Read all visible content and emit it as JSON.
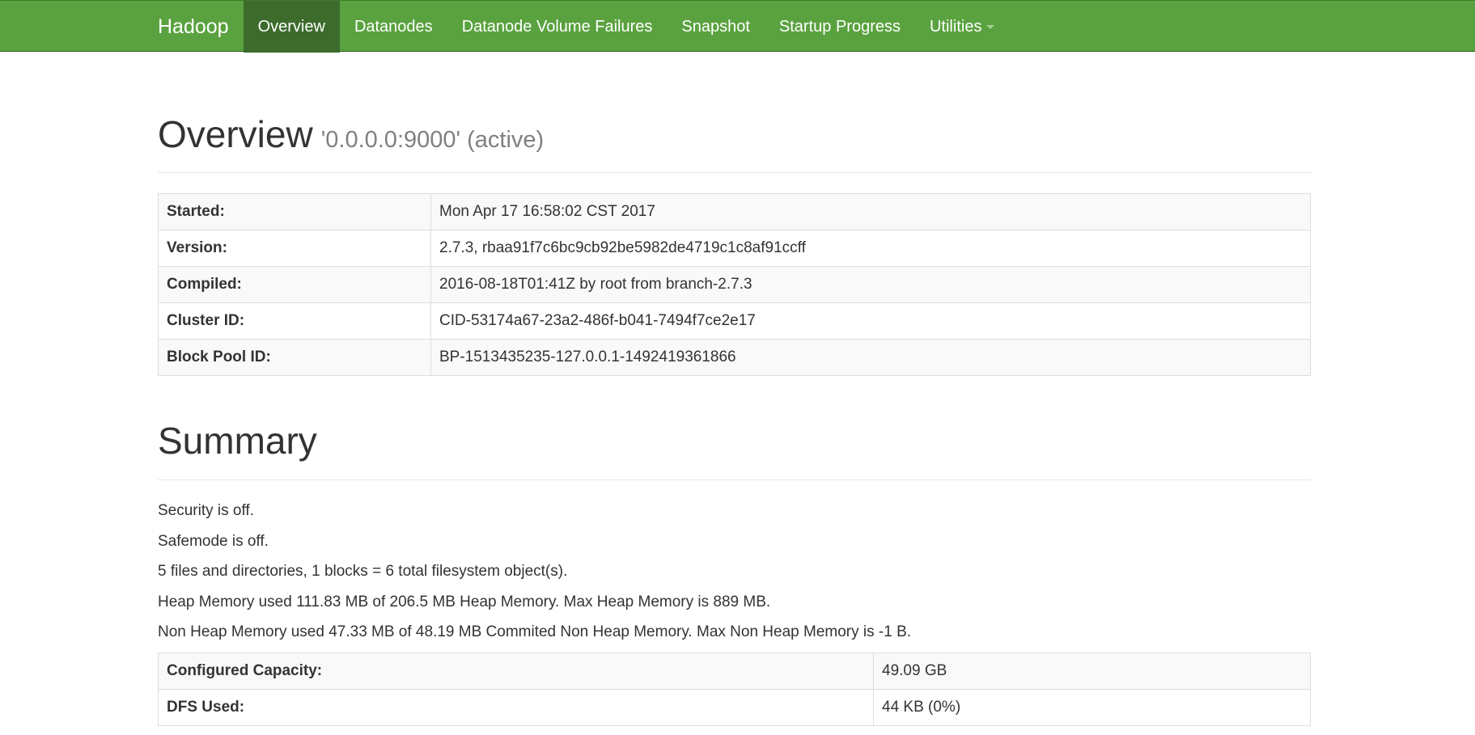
{
  "navbar": {
    "brand": "Hadoop",
    "items": [
      {
        "label": "Overview",
        "active": true
      },
      {
        "label": "Datanodes",
        "active": false
      },
      {
        "label": "Datanode Volume Failures",
        "active": false
      },
      {
        "label": "Snapshot",
        "active": false
      },
      {
        "label": "Startup Progress",
        "active": false
      },
      {
        "label": "Utilities",
        "active": false,
        "dropdown": true
      }
    ],
    "bg_color": "#5aa23f",
    "active_color": "#3c6b2c"
  },
  "overview": {
    "title": "Overview",
    "subtitle": "'0.0.0.0:9000' (active)",
    "rows": [
      {
        "key": "Started:",
        "value": "Mon Apr 17 16:58:02 CST 2017"
      },
      {
        "key": "Version:",
        "value": "2.7.3, rbaa91f7c6bc9cb92be5982de4719c1c8af91ccff"
      },
      {
        "key": "Compiled:",
        "value": "2016-08-18T01:41Z by root from branch-2.7.3"
      },
      {
        "key": "Cluster ID:",
        "value": "CID-53174a67-23a2-486f-b041-7494f7ce2e17"
      },
      {
        "key": "Block Pool ID:",
        "value": "BP-1513435235-127.0.0.1-1492419361866"
      }
    ]
  },
  "summary": {
    "title": "Summary",
    "lines": [
      "Security is off.",
      "Safemode is off.",
      "5 files and directories, 1 blocks = 6 total filesystem object(s).",
      "Heap Memory used 111.83 MB of 206.5 MB Heap Memory. Max Heap Memory is 889 MB.",
      "Non Heap Memory used 47.33 MB of 48.19 MB Commited Non Heap Memory. Max Non Heap Memory is -1 B."
    ],
    "rows": [
      {
        "key": "Configured Capacity:",
        "value": "49.09 GB"
      },
      {
        "key": "DFS Used:",
        "value": "44 KB (0%)"
      }
    ]
  }
}
